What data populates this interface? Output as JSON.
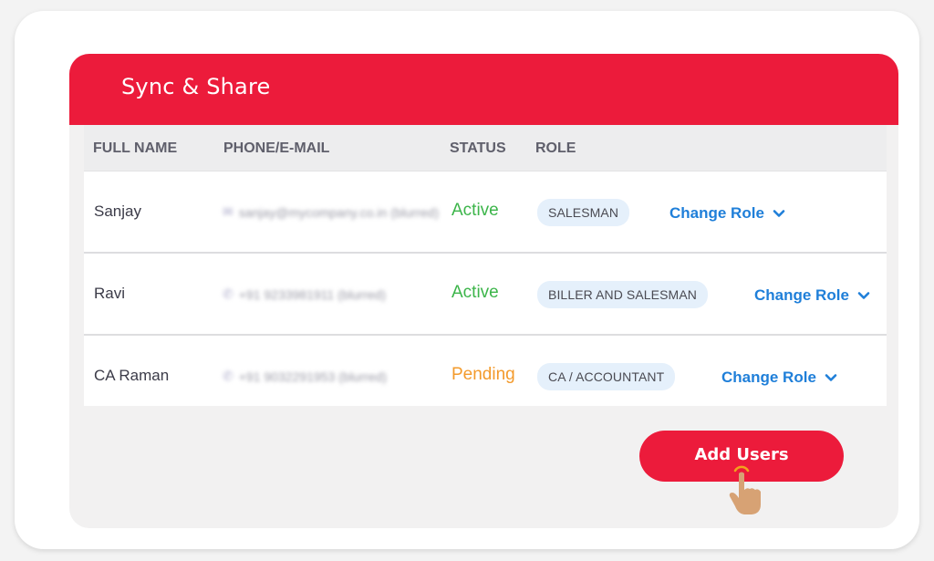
{
  "panel": {
    "title": "Sync & Share",
    "accent_color": "#ec1b3b"
  },
  "table": {
    "columns": [
      "FULL NAME",
      "PHONE/E-MAIL",
      "STATUS",
      "ROLE"
    ],
    "rows": [
      {
        "name": "Sanjay",
        "contact_icon": "email-icon",
        "contact": "sanjay@mycompany.co.in (blurred)",
        "status": "Active",
        "status_color": "#3cb54a",
        "role": "SALESMAN",
        "action": "Change Role"
      },
      {
        "name": "Ravi",
        "contact_icon": "phone-icon",
        "contact": "+91 9233981911 (blurred)",
        "status": "Active",
        "status_color": "#3cb54a",
        "role": "BILLER AND SALESMAN",
        "action": "Change Role"
      },
      {
        "name": "CA Raman",
        "contact_icon": "phone-icon",
        "contact": "+91 9032291953 (blurred)",
        "status": "Pending",
        "status_color": "#f39a2b",
        "role": "CA / ACCOUNTANT",
        "action": "Change Role"
      }
    ]
  },
  "add_users_label": "Add Users"
}
